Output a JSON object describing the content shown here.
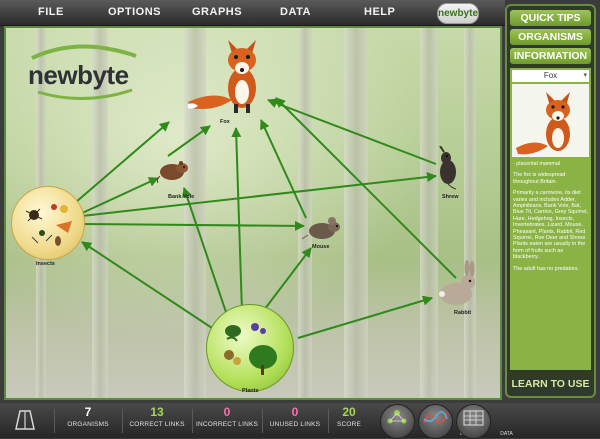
{
  "menu": {
    "items": [
      "FILE",
      "OPTIONS",
      "GRAPHS",
      "DATA",
      "HELP"
    ],
    "logo_text": "newbyte"
  },
  "canvas": {
    "brand": "newbyte",
    "nodes": {
      "fox": "Fox",
      "bank_vole": "Bank Vole",
      "shrew": "Shrew",
      "insects": "Insects",
      "mouse": "Mouse",
      "rabbit": "Rabbit",
      "plants": "Plants"
    }
  },
  "side": {
    "quick_tips": "QUICK TIPS",
    "organisms": "ORGANISMS",
    "information": "INFORMATION",
    "selected_organism": "Fox",
    "info_paragraphs": [
      "- placental mammal",
      "The fox is widespread throughout Britain.",
      "Primarily a carnivore, its diet varies and includes Adder, Amphibians, Bank Vole, Bat, Blue Tit, Carrion, Grey Squirrel, Hare, Hedgehog, Insects, Invertebrates, Lizard, Mouse, Pheasant, Plants, Rabbit, Red Squirrel, Roe Deer and Shrew. Plants eaten are usually in the form of fruits such as blackberry.",
      "The adult has no predators."
    ],
    "learn_to_use": "LEARN TO USE"
  },
  "stats": [
    {
      "value": "7",
      "label": "ORGANISMS",
      "color": "#ffffff"
    },
    {
      "value": "13",
      "label": "CORRECT LINKS",
      "color": "#a6d65a"
    },
    {
      "value": "0",
      "label": "INCORRECT LINKS",
      "color": "#ff6fa8"
    },
    {
      "value": "0",
      "label": "UNUSED LINKS",
      "color": "#ff6fa8"
    },
    {
      "value": "20",
      "label": "SCORE",
      "color": "#a6d65a"
    }
  ],
  "view_buttons": {
    "web": "WEB",
    "model": "MODEL",
    "data": "DATA"
  },
  "colors": {
    "arrow": "#2f8a1a",
    "accent": "#8bb245"
  }
}
